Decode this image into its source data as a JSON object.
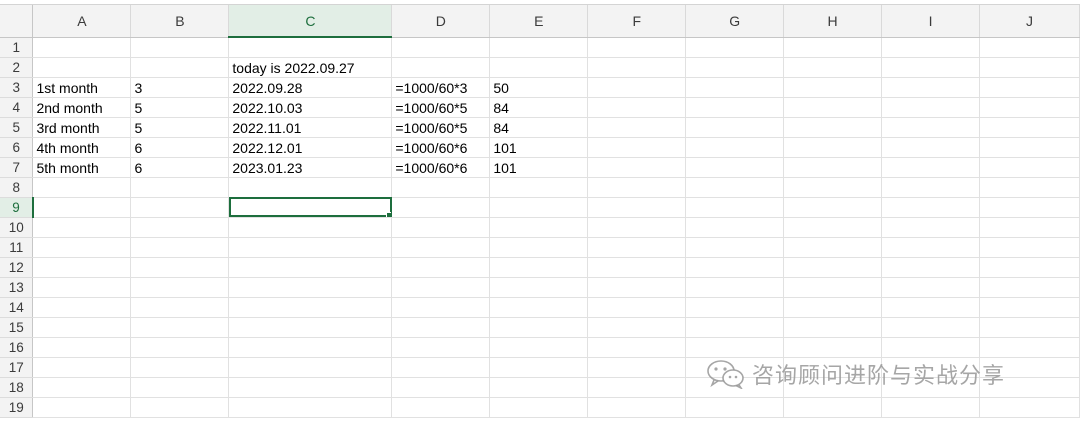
{
  "sheet": {
    "columns": [
      "A",
      "B",
      "C",
      "D",
      "E",
      "F",
      "G",
      "H",
      "I",
      "J"
    ],
    "selected_column": "C",
    "selected_row": "9",
    "active_cell": "C9",
    "rows": [
      {
        "num": "1",
        "cells": [
          "",
          "",
          "",
          "",
          "",
          "",
          "",
          "",
          "",
          ""
        ]
      },
      {
        "num": "2",
        "cells": [
          "",
          "",
          "today is 2022.09.27",
          "",
          "",
          "",
          "",
          "",
          "",
          ""
        ]
      },
      {
        "num": "3",
        "cells": [
          "1st month",
          "3",
          "2022.09.28",
          "=1000/60*3",
          "50",
          "",
          "",
          "",
          "",
          ""
        ]
      },
      {
        "num": "4",
        "cells": [
          "2nd month",
          "5",
          "2022.10.03",
          "=1000/60*5",
          "84",
          "",
          "",
          "",
          "",
          ""
        ]
      },
      {
        "num": "5",
        "cells": [
          "3rd month",
          "5",
          "2022.11.01",
          "=1000/60*5",
          "84",
          "",
          "",
          "",
          "",
          ""
        ]
      },
      {
        "num": "6",
        "cells": [
          "4th month",
          "6",
          "2022.12.01",
          "=1000/60*6",
          "101",
          "",
          "",
          "",
          "",
          ""
        ]
      },
      {
        "num": "7",
        "cells": [
          "5th month",
          "6",
          "2023.01.23",
          "=1000/60*6",
          "101",
          "",
          "",
          "",
          "",
          ""
        ]
      },
      {
        "num": "8",
        "cells": [
          "",
          "",
          "",
          "",
          "",
          "",
          "",
          "",
          "",
          ""
        ]
      },
      {
        "num": "9",
        "cells": [
          "",
          "",
          "",
          "",
          "",
          "",
          "",
          "",
          "",
          ""
        ]
      },
      {
        "num": "10",
        "cells": [
          "",
          "",
          "",
          "",
          "",
          "",
          "",
          "",
          "",
          ""
        ]
      },
      {
        "num": "11",
        "cells": [
          "",
          "",
          "",
          "",
          "",
          "",
          "",
          "",
          "",
          ""
        ]
      },
      {
        "num": "12",
        "cells": [
          "",
          "",
          "",
          "",
          "",
          "",
          "",
          "",
          "",
          ""
        ]
      },
      {
        "num": "13",
        "cells": [
          "",
          "",
          "",
          "",
          "",
          "",
          "",
          "",
          "",
          ""
        ]
      },
      {
        "num": "14",
        "cells": [
          "",
          "",
          "",
          "",
          "",
          "",
          "",
          "",
          "",
          ""
        ]
      },
      {
        "num": "15",
        "cells": [
          "",
          "",
          "",
          "",
          "",
          "",
          "",
          "",
          "",
          ""
        ]
      },
      {
        "num": "16",
        "cells": [
          "",
          "",
          "",
          "",
          "",
          "",
          "",
          "",
          "",
          ""
        ]
      },
      {
        "num": "17",
        "cells": [
          "",
          "",
          "",
          "",
          "",
          "",
          "",
          "",
          "",
          ""
        ]
      },
      {
        "num": "18",
        "cells": [
          "",
          "",
          "",
          "",
          "",
          "",
          "",
          "",
          "",
          ""
        ]
      },
      {
        "num": "19",
        "cells": [
          "",
          "",
          "",
          "",
          "",
          "",
          "",
          "",
          "",
          ""
        ]
      }
    ]
  },
  "watermark": {
    "text": "咨询顾问进阶与实战分享",
    "icon": "wechat-icon"
  },
  "colors": {
    "accent": "#1d6e3d",
    "header_bg": "#f3f3f3",
    "selected_header_bg": "#e2eee6",
    "gridline": "#e1e1e1"
  }
}
